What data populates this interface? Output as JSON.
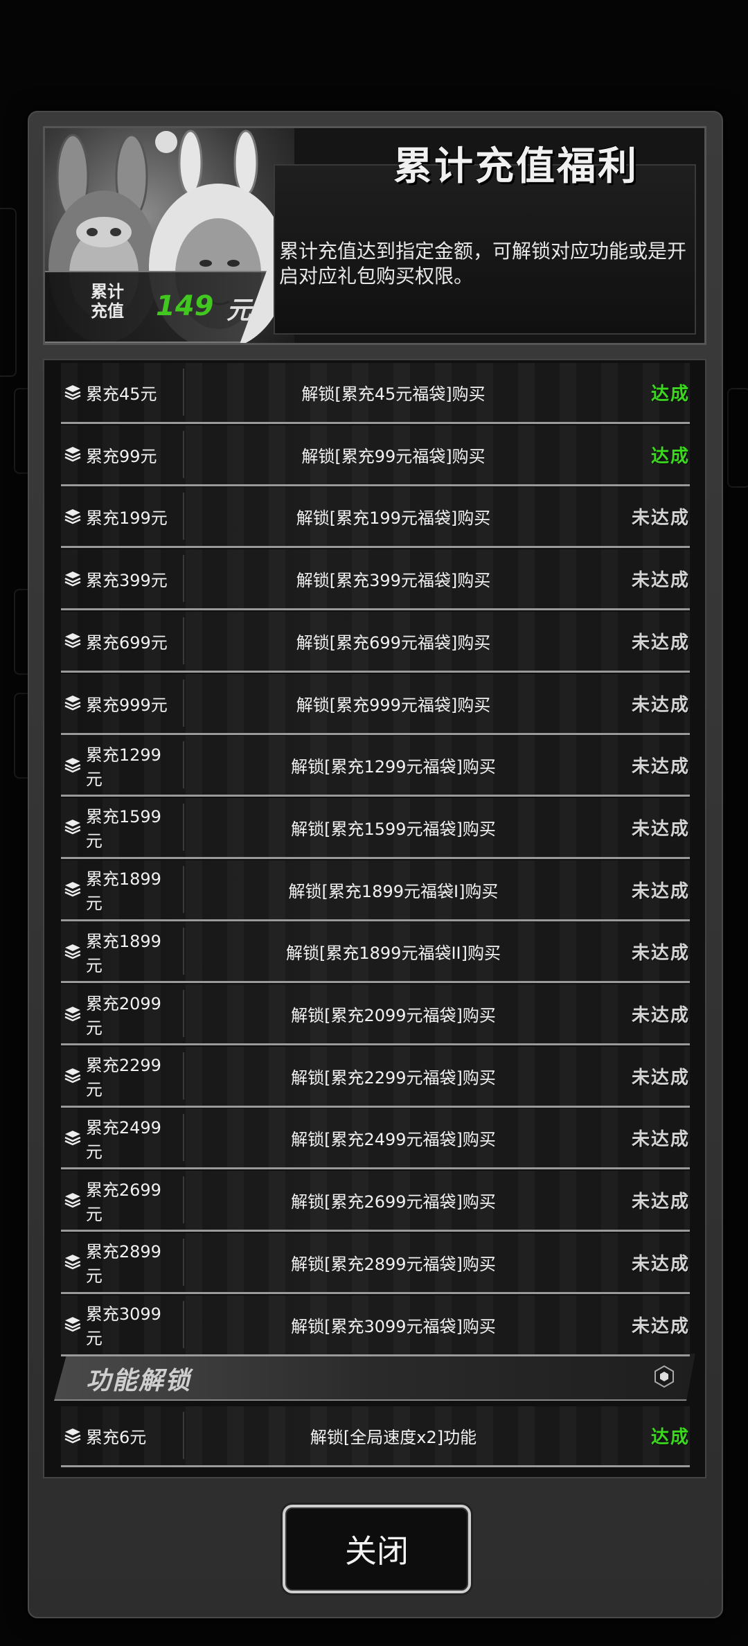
{
  "header": {
    "title": "累计充值福利",
    "description": "累计充值达到指定金额，可解锁对应功能或是开启对应礼包购买权限。",
    "total_label": "累计\n充值",
    "total_value": "149",
    "total_unit": "元"
  },
  "rows": [
    {
      "amount": "累充45元",
      "desc": "解锁[累充45元福袋]购买",
      "status": "达成",
      "done": true
    },
    {
      "amount": "累充99元",
      "desc": "解锁[累充99元福袋]购买",
      "status": "达成",
      "done": true
    },
    {
      "amount": "累充199元",
      "desc": "解锁[累充199元福袋]购买",
      "status": "未达成",
      "done": false
    },
    {
      "amount": "累充399元",
      "desc": "解锁[累充399元福袋]购买",
      "status": "未达成",
      "done": false
    },
    {
      "amount": "累充699元",
      "desc": "解锁[累充699元福袋]购买",
      "status": "未达成",
      "done": false
    },
    {
      "amount": "累充999元",
      "desc": "解锁[累充999元福袋]购买",
      "status": "未达成",
      "done": false
    },
    {
      "amount": "累充1299元",
      "desc": "解锁[累充1299元福袋]购买",
      "status": "未达成",
      "done": false
    },
    {
      "amount": "累充1599元",
      "desc": "解锁[累充1599元福袋]购买",
      "status": "未达成",
      "done": false
    },
    {
      "amount": "累充1899元",
      "desc": "解锁[累充1899元福袋I]购买",
      "status": "未达成",
      "done": false
    },
    {
      "amount": "累充1899元",
      "desc": "解锁[累充1899元福袋II]购买",
      "status": "未达成",
      "done": false
    },
    {
      "amount": "累充2099元",
      "desc": "解锁[累充2099元福袋]购买",
      "status": "未达成",
      "done": false
    },
    {
      "amount": "累充2299元",
      "desc": "解锁[累充2299元福袋]购买",
      "status": "未达成",
      "done": false
    },
    {
      "amount": "累充2499元",
      "desc": "解锁[累充2499元福袋]购买",
      "status": "未达成",
      "done": false
    },
    {
      "amount": "累充2699元",
      "desc": "解锁[累充2699元福袋]购买",
      "status": "未达成",
      "done": false
    },
    {
      "amount": "累充2899元",
      "desc": "解锁[累充2899元福袋]购买",
      "status": "未达成",
      "done": false
    },
    {
      "amount": "累充3099元",
      "desc": "解锁[累充3099元福袋]购买",
      "status": "未达成",
      "done": false
    }
  ],
  "section": {
    "title": "功能解锁",
    "icon": "hexagon-icon"
  },
  "feature_rows": [
    {
      "amount": "累充6元",
      "desc": "解锁[全局速度x2]功能",
      "status": "达成",
      "done": true
    }
  ],
  "buttons": {
    "close_label": "关闭"
  },
  "colors": {
    "done": "#3bd81f",
    "todo": "#d4d4d4",
    "total_value": "#41c720"
  }
}
